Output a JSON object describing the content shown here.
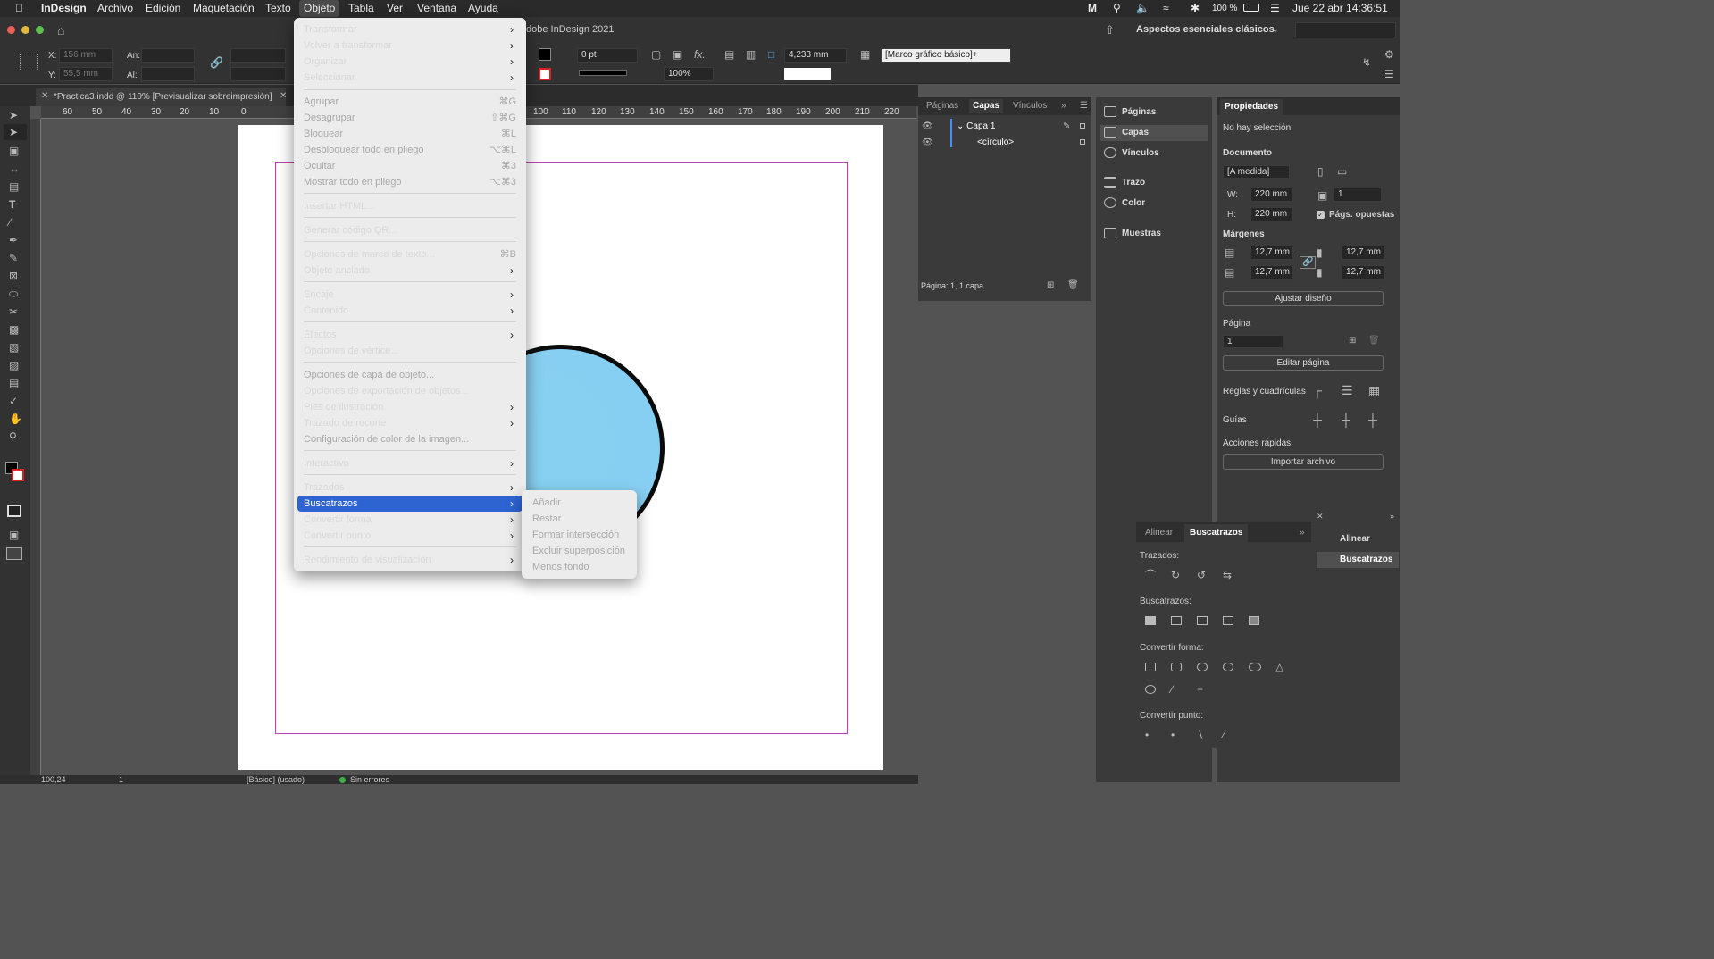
{
  "menubar": {
    "app": "InDesign",
    "items": [
      "Archivo",
      "Edición",
      "Maquetación",
      "Texto",
      "Objeto",
      "Tabla",
      "Ver",
      "Ventana",
      "Ayuda"
    ],
    "active": "Objeto",
    "battery": "100 %",
    "datetime": "Jue 22 abr  14:36:51"
  },
  "appbar": {
    "title": "dobe InDesign 2021",
    "workspace": "Aspectos esenciales clásicos"
  },
  "control": {
    "x_label": "X:",
    "x_value": "156 mm",
    "y_label": "Y:",
    "y_value": "55,5 mm",
    "w_label": "An:",
    "h_label": "Al:",
    "stroke_weight": "0 pt",
    "zoom_pct": "100%",
    "corner": "4,233 mm",
    "frame_style": "[Marco gráfico básico]+"
  },
  "doc_tab": "*Practica3.indd @ 110% [Previsualizar sobreimpresión]",
  "ruler": {
    "left": [
      "60",
      "50",
      "40",
      "30",
      "20",
      "10",
      "0"
    ],
    "right": [
      "100",
      "110",
      "120",
      "130",
      "140",
      "150",
      "160",
      "170",
      "180",
      "190",
      "200",
      "210",
      "220"
    ]
  },
  "objeto_menu": {
    "items": [
      {
        "label": "Transformar",
        "submenu": true
      },
      {
        "label": "Volver a transformar",
        "submenu": true
      },
      {
        "label": "Organizar",
        "submenu": true
      },
      {
        "label": "Seleccionar",
        "submenu": true
      },
      {
        "label": "Agrupar",
        "shortcut": "⌘G",
        "disabled": true
      },
      {
        "label": "Desagrupar",
        "shortcut": "⇧⌘G",
        "disabled": true
      },
      {
        "label": "Bloquear",
        "shortcut": "⌘L",
        "disabled": true
      },
      {
        "label": "Desbloquear todo en pliego",
        "shortcut": "⌥⌘L",
        "disabled": true
      },
      {
        "label": "Ocultar",
        "shortcut": "⌘3",
        "disabled": true
      },
      {
        "label": "Mostrar todo en pliego",
        "shortcut": "⌥⌘3",
        "disabled": true
      },
      {
        "label": "Insertar HTML..."
      },
      {
        "label": "Generar código QR..."
      },
      {
        "label": "Opciones de marco de texto...",
        "shortcut": "⌘B"
      },
      {
        "label": "Objeto anclado",
        "submenu": true
      },
      {
        "label": "Encaje",
        "submenu": true
      },
      {
        "label": "Contenido",
        "submenu": true
      },
      {
        "label": "Efectos",
        "submenu": true
      },
      {
        "label": "Opciones de vértice..."
      },
      {
        "label": "Opciones de capa de objeto...",
        "disabled": true
      },
      {
        "label": "Opciones de exportación de objetos..."
      },
      {
        "label": "Pies de ilustración",
        "submenu": true
      },
      {
        "label": "Trazado de recorte",
        "submenu": true
      },
      {
        "label": "Configuración de color de la imagen...",
        "disabled": true
      },
      {
        "label": "Interactivo",
        "submenu": true
      },
      {
        "label": "Trazados",
        "submenu": true
      },
      {
        "label": "Buscatrazos",
        "submenu": true,
        "highlighted": true
      },
      {
        "label": "Convertir forma",
        "submenu": true
      },
      {
        "label": "Convertir punto",
        "submenu": true
      },
      {
        "label": "Rendimiento de visualización",
        "submenu": true
      }
    ]
  },
  "buscatrazos_submenu": [
    "Añadir",
    "Restar",
    "Formar intersección",
    "Excluir superposición",
    "Menos fondo"
  ],
  "layers_panel": {
    "tabs": [
      "Páginas",
      "Capas",
      "Vínculos"
    ],
    "active": "Capas",
    "layer": "Capa 1",
    "object": "<círculo>",
    "footer": "Página: 1, 1 capa"
  },
  "dock": [
    "Páginas",
    "Capas",
    "Vínculos",
    "Trazo",
    "Color",
    "Muestras"
  ],
  "properties": {
    "title": "Propiedades",
    "no_selection": "No hay selección",
    "documento": "Documento",
    "preset": "[A medida]",
    "w_label": "W:",
    "w": "220 mm",
    "h_label": "H:",
    "h": "220 mm",
    "pages": "1",
    "facing": "Págs. opuestas",
    "margenes": "Márgenes",
    "m_top": "12,7 mm",
    "m_bottom": "12,7 mm",
    "m_left": "12,7 mm",
    "m_right": "12,7 mm",
    "ajustar": "Ajustar diseño",
    "pagina": "Página",
    "page_no": "1",
    "editar": "Editar página",
    "reglas": "Reglas y cuadrículas",
    "guias": "Guías",
    "acciones": "Acciones rápidas",
    "importar": "Importar archivo"
  },
  "pathfinder": {
    "tabs": [
      "Alinear",
      "Buscatrazos"
    ],
    "active": "Buscatrazos",
    "trazados": "Trazados:",
    "buscatrazos": "Buscatrazos:",
    "convertir_forma": "Convertir forma:",
    "convertir_punto": "Convertir punto:"
  },
  "pf_dock": [
    "Alinear",
    "Buscatrazos"
  ],
  "status": {
    "zoom": "100,24",
    "page": "1",
    "style": "[Básico] (usado)",
    "errors": "Sin errores"
  }
}
